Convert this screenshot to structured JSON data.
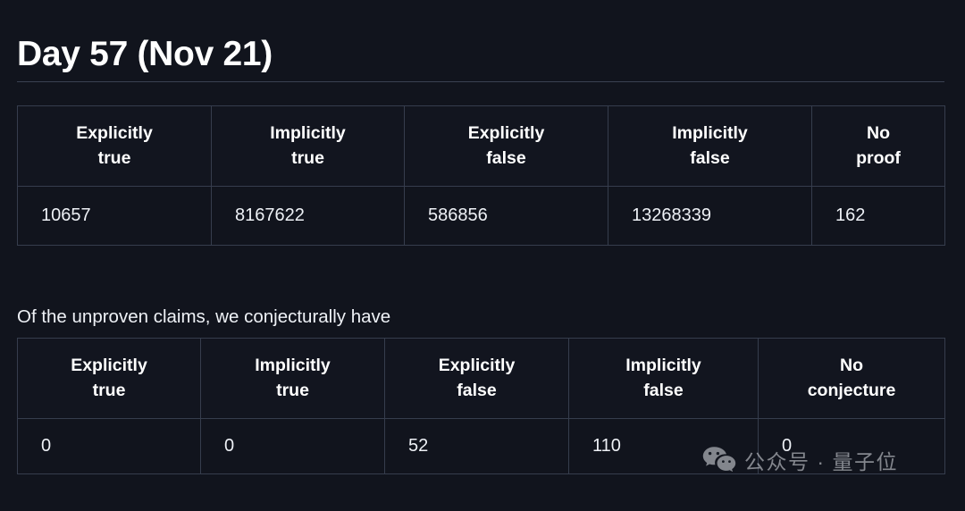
{
  "document": {
    "title": "Day 57 (Nov 21)",
    "lead_text": "Of the unproven claims, we conjecturally have"
  },
  "colors": {
    "background": "#11141d",
    "text": "#eef1f6",
    "heading": "#ffffff",
    "border": "#363d4d",
    "rule": "#3a4152",
    "watermark": "#c9ccd2"
  },
  "tables": {
    "claims": {
      "headers": [
        "Explicitly true",
        "Implicitly true",
        "Explicitly false",
        "Implicitly false",
        "No proof"
      ],
      "header_lines": [
        [
          "Explicitly",
          "true"
        ],
        [
          "Implicitly",
          "true"
        ],
        [
          "Explicitly",
          "false"
        ],
        [
          "Implicitly",
          "false"
        ],
        [
          "No",
          "proof"
        ]
      ],
      "values": [
        "10657",
        "8167622",
        "586856",
        "13268339",
        "162"
      ]
    },
    "conjecture": {
      "headers": [
        "Explicitly true",
        "Implicitly true",
        "Explicitly false",
        "Implicitly false",
        "No conjecture"
      ],
      "header_lines": [
        [
          "Explicitly",
          "true"
        ],
        [
          "Implicitly",
          "true"
        ],
        [
          "Explicitly",
          "false"
        ],
        [
          "Implicitly",
          "false"
        ],
        [
          "No",
          "conjecture"
        ]
      ],
      "values": [
        "0",
        "0",
        "52",
        "110",
        "0"
      ]
    }
  },
  "watermark": {
    "icon": "wechat-icon",
    "text": "公众号 · 量子位"
  }
}
